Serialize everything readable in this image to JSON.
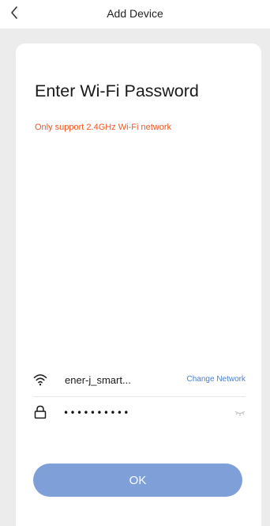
{
  "header": {
    "title": "Add Device",
    "back_icon": "chevron-left-icon"
  },
  "card": {
    "title": "Enter Wi-Fi Password",
    "notice": "Only support 2.4GHz Wi-Fi network",
    "notice_color": "#f2571f"
  },
  "wifi": {
    "icon": "wifi-icon",
    "network_name": "ener-j_smart...",
    "change_label": "Change Network",
    "change_color": "#4a7fd0"
  },
  "password": {
    "icon": "lock-icon",
    "value": "••••••••••",
    "toggle_icon": "eye-closed-icon"
  },
  "actions": {
    "ok_label": "OK",
    "ok_color": "#7f9fd8"
  }
}
